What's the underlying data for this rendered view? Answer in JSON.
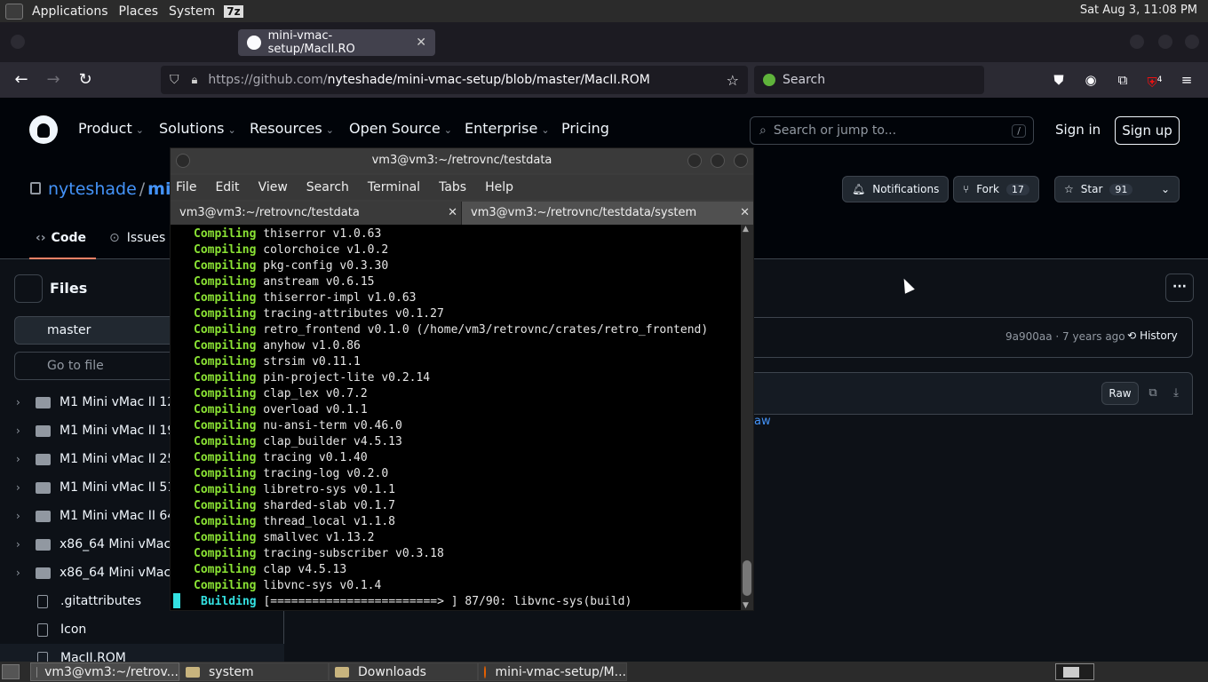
{
  "system_panel": {
    "menu": [
      "Applications",
      "Places",
      "System"
    ],
    "badge": "7z",
    "clock": "Sat Aug  3, 11:08 PM"
  },
  "browser": {
    "tab_title": "mini-vmac-setup/MacII.RO",
    "url_host": "https://github.com/",
    "url_path": "nyteshade/mini-vmac-setup/blob/master/MacII.ROM",
    "search_placeholder": "Search",
    "extension_badge": "4"
  },
  "github": {
    "nav": [
      "Product",
      "Solutions",
      "Resources",
      "Open Source",
      "Enterprise",
      "Pricing"
    ],
    "search_placeholder": "Search or jump to...",
    "search_shortcut": "/",
    "sign_in": "Sign in",
    "sign_up": "Sign up",
    "repo_owner": "nyteshade",
    "repo_sep": "/",
    "repo_name_partial": "mi",
    "notifications": "Notifications",
    "fork_label": "Fork",
    "fork_count": "17",
    "star_label": "Star",
    "star_count": "91",
    "tab_code": "Code",
    "tab_issues": "Issues"
  },
  "file_tree": {
    "title": "Files",
    "branch": "master",
    "goto_placeholder": "Go to file",
    "items": [
      {
        "type": "folder",
        "name": "M1 Mini vMac II 1280"
      },
      {
        "type": "folder",
        "name": "M1 Mini vMac II 1920"
      },
      {
        "type": "folder",
        "name": "M1 Mini vMac II 2560"
      },
      {
        "type": "folder",
        "name": "M1 Mini vMac II 512"
      },
      {
        "type": "folder",
        "name": "M1 Mini vMac II 640"
      },
      {
        "type": "folder",
        "name": "x86_64 Mini vMac 12"
      },
      {
        "type": "folder",
        "name": "x86_64 Mini vMac 80"
      },
      {
        "type": "file",
        "name": ".gitattributes"
      },
      {
        "type": "file",
        "name": "Icon"
      },
      {
        "type": "file",
        "name": "MacII.ROM"
      }
    ]
  },
  "file_panel": {
    "commit_info": "9a900aa · 7 years ago",
    "history": "History",
    "raw": "Raw",
    "raw_link_fragment": "aw"
  },
  "terminal": {
    "title": "vm3@vm3:~/retrovnc/testdata",
    "menu": [
      "File",
      "Edit",
      "View",
      "Search",
      "Terminal",
      "Tabs",
      "Help"
    ],
    "tabs": [
      "vm3@vm3:~/retrovnc/testdata",
      "vm3@vm3:~/retrovnc/testdata/system"
    ],
    "lines": [
      {
        "kw": "Compiling",
        "text": "thiserror v1.0.63"
      },
      {
        "kw": "Compiling",
        "text": "colorchoice v1.0.2"
      },
      {
        "kw": "Compiling",
        "text": "pkg-config v0.3.30"
      },
      {
        "kw": "Compiling",
        "text": "anstream v0.6.15"
      },
      {
        "kw": "Compiling",
        "text": "thiserror-impl v1.0.63"
      },
      {
        "kw": "Compiling",
        "text": "tracing-attributes v0.1.27"
      },
      {
        "kw": "Compiling",
        "text": "retro_frontend v0.1.0 (/home/vm3/retrovnc/crates/retro_frontend)"
      },
      {
        "kw": "Compiling",
        "text": "anyhow v1.0.86"
      },
      {
        "kw": "Compiling",
        "text": "strsim v0.11.1"
      },
      {
        "kw": "Compiling",
        "text": "pin-project-lite v0.2.14"
      },
      {
        "kw": "Compiling",
        "text": "clap_lex v0.7.2"
      },
      {
        "kw": "Compiling",
        "text": "overload v0.1.1"
      },
      {
        "kw": "Compiling",
        "text": "nu-ansi-term v0.46.0"
      },
      {
        "kw": "Compiling",
        "text": "clap_builder v4.5.13"
      },
      {
        "kw": "Compiling",
        "text": "tracing v0.1.40"
      },
      {
        "kw": "Compiling",
        "text": "tracing-log v0.2.0"
      },
      {
        "kw": "Compiling",
        "text": "libretro-sys v0.1.1"
      },
      {
        "kw": "Compiling",
        "text": "sharded-slab v0.1.7"
      },
      {
        "kw": "Compiling",
        "text": "thread_local v1.1.8"
      },
      {
        "kw": "Compiling",
        "text": "smallvec v1.13.2"
      },
      {
        "kw": "Compiling",
        "text": "tracing-subscriber v0.3.18"
      },
      {
        "kw": "Compiling",
        "text": "clap v4.5.13"
      },
      {
        "kw": "Compiling",
        "text": "libvnc-sys v0.1.4"
      }
    ],
    "building_kw": "Building",
    "building_text": "[========================> ] 87/90: libvnc-sys(build)"
  },
  "taskbar": {
    "tasks": [
      "vm3@vm3:~/retrov...",
      "system",
      "Downloads",
      "mini-vmac-setup/M..."
    ]
  },
  "colors": {
    "terminal_keyword": "#8ae234",
    "terminal_building": "#34e2e2",
    "github_link": "#4493f8"
  }
}
